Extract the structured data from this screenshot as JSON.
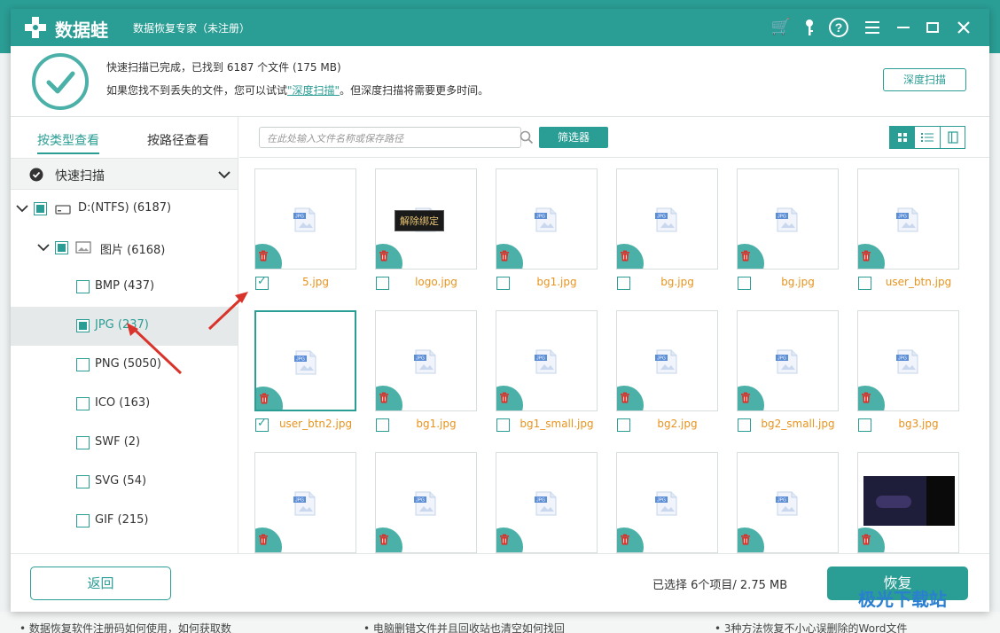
{
  "app": {
    "brand": "数据蛙",
    "subtitle": "数据恢复专家（未注册）",
    "bg_text": "数据蛙"
  },
  "titlebar_icons": [
    "cart-icon",
    "key-icon",
    "help-icon",
    "menu-icon",
    "minimize-icon",
    "close-icon"
  ],
  "status": {
    "line1": "快速扫描已完成，已找到 6187 个文件 (175 MB)",
    "line2_prefix": "如果您找不到丢失的文件，您可以试试",
    "line2_link": "\"深度扫描\"",
    "line2_suffix": "。但深度扫描将需要更多时间。",
    "deep_scan_button": "深度扫描"
  },
  "sidebar": {
    "tabs": [
      "按类型查看",
      "按路径查看"
    ],
    "quick_scan": "快速扫描",
    "drive": "D:(NTFS) (6187)",
    "folder": "图片 (6168)",
    "types": [
      "BMP (437)",
      "JPG (237)",
      "PNG (5050)",
      "ICO (163)",
      "SWF (2)",
      "SVG (54)",
      "GIF (215)"
    ],
    "selected_type": "JPG (237)"
  },
  "toolbar": {
    "search_placeholder": "在此处输入文件名称或保存路径",
    "filter_button": "筛选器"
  },
  "files": [
    {
      "name": "5.jpg",
      "checked": true
    },
    {
      "name": "logo.jpg",
      "checked": false
    },
    {
      "name": "bg1.jpg",
      "checked": false
    },
    {
      "name": "bg.jpg",
      "checked": false
    },
    {
      "name": "bg.jpg",
      "checked": false
    },
    {
      "name": "user_btn.jpg",
      "checked": false
    },
    {
      "name": "user_btn2.jpg",
      "checked": true
    },
    {
      "name": "bg1.jpg",
      "checked": false
    },
    {
      "name": "bg1_small.jpg",
      "checked": false
    },
    {
      "name": "bg2.jpg",
      "checked": false
    },
    {
      "name": "bg2_small.jpg",
      "checked": false
    },
    {
      "name": "bg3.jpg",
      "checked": false
    }
  ],
  "file_icon_label": "JPG",
  "tooltip": "解除绑定",
  "bottom": {
    "back_button": "返回",
    "selection_info": "已选择 6个项目/ 2.75 MB",
    "recover_button": "恢复"
  },
  "background_footer": [
    "• 数据恢复软件注册码如何使用，如何获取数",
    "• 电脑删错文件并且回收站也清空如何找回",
    "• 3种方法恢复不小心误删除的Word文件"
  ],
  "watermark": "极光下载站",
  "colors": {
    "accent": "#2a9d94",
    "file_name": "#e8931d",
    "arrow": "#d9342b"
  }
}
